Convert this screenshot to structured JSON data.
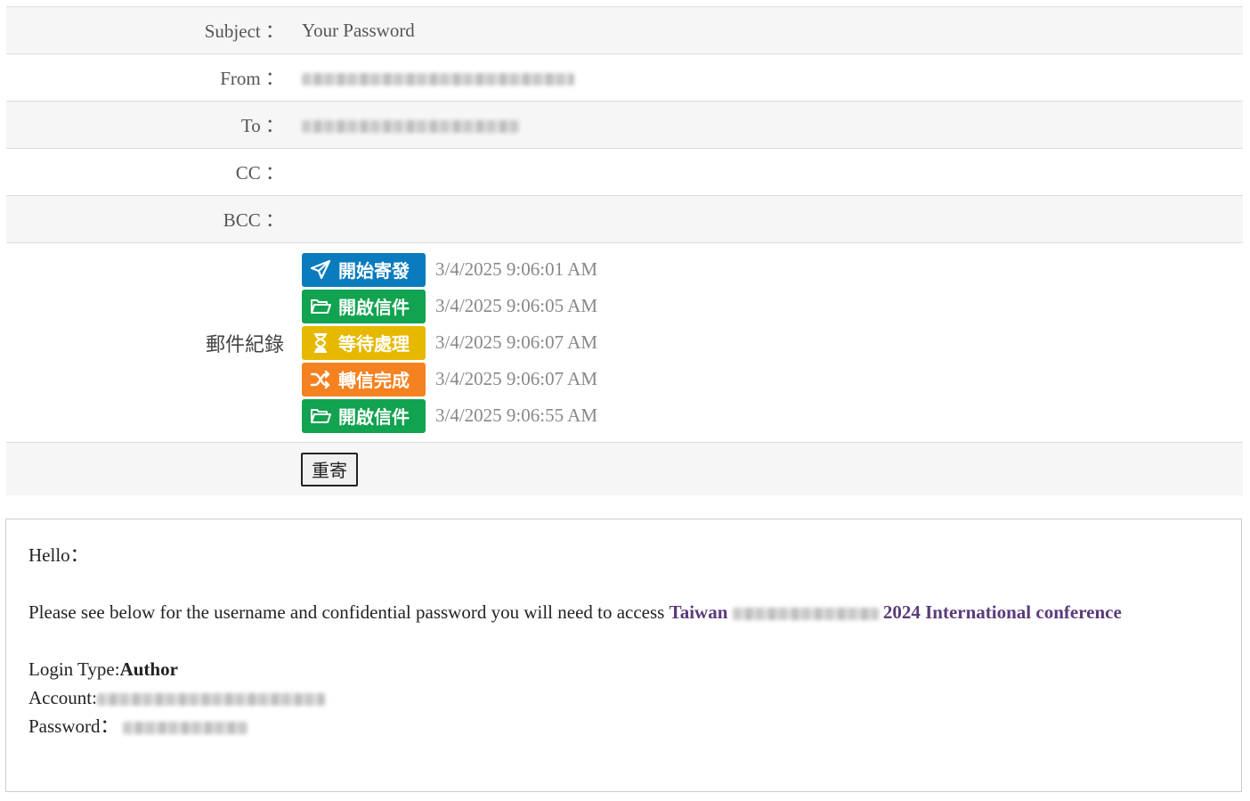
{
  "header": {
    "subject_label": "Subject ：",
    "subject_value": "Your Password",
    "from_label": "From ：",
    "to_label": "To ：",
    "cc_label": "CC ：",
    "bcc_label": "BCC ："
  },
  "log": {
    "label": "郵件紀錄",
    "entries": [
      {
        "status": "開始寄發",
        "icon": "paper-plane-icon",
        "color": "#0a7bbd",
        "time": "3/4/2025 9:06:01 AM"
      },
      {
        "status": "開啟信件",
        "icon": "folder-open-icon",
        "color": "#11a34f",
        "time": "3/4/2025 9:06:05 AM"
      },
      {
        "status": "等待處理",
        "icon": "hourglass-icon",
        "color": "#e6b800",
        "time": "3/4/2025 9:06:07 AM"
      },
      {
        "status": "轉信完成",
        "icon": "shuffle-icon",
        "color": "#f58220",
        "time": "3/4/2025 9:06:07 AM"
      },
      {
        "status": "開啟信件",
        "icon": "folder-open-icon",
        "color": "#11a34f",
        "time": "3/4/2025 9:06:55 AM"
      }
    ]
  },
  "resend_label": "重寄",
  "body": {
    "greeting": "Hello：",
    "intro": "Please see below for the username and confidential password you will need to access ",
    "conf_prefix": "Taiwan",
    "conf_suffix": "2024 International conference",
    "login_type_label": "Login Type:",
    "login_type_value": "Author",
    "account_label": "Account:",
    "password_label": "Password："
  }
}
